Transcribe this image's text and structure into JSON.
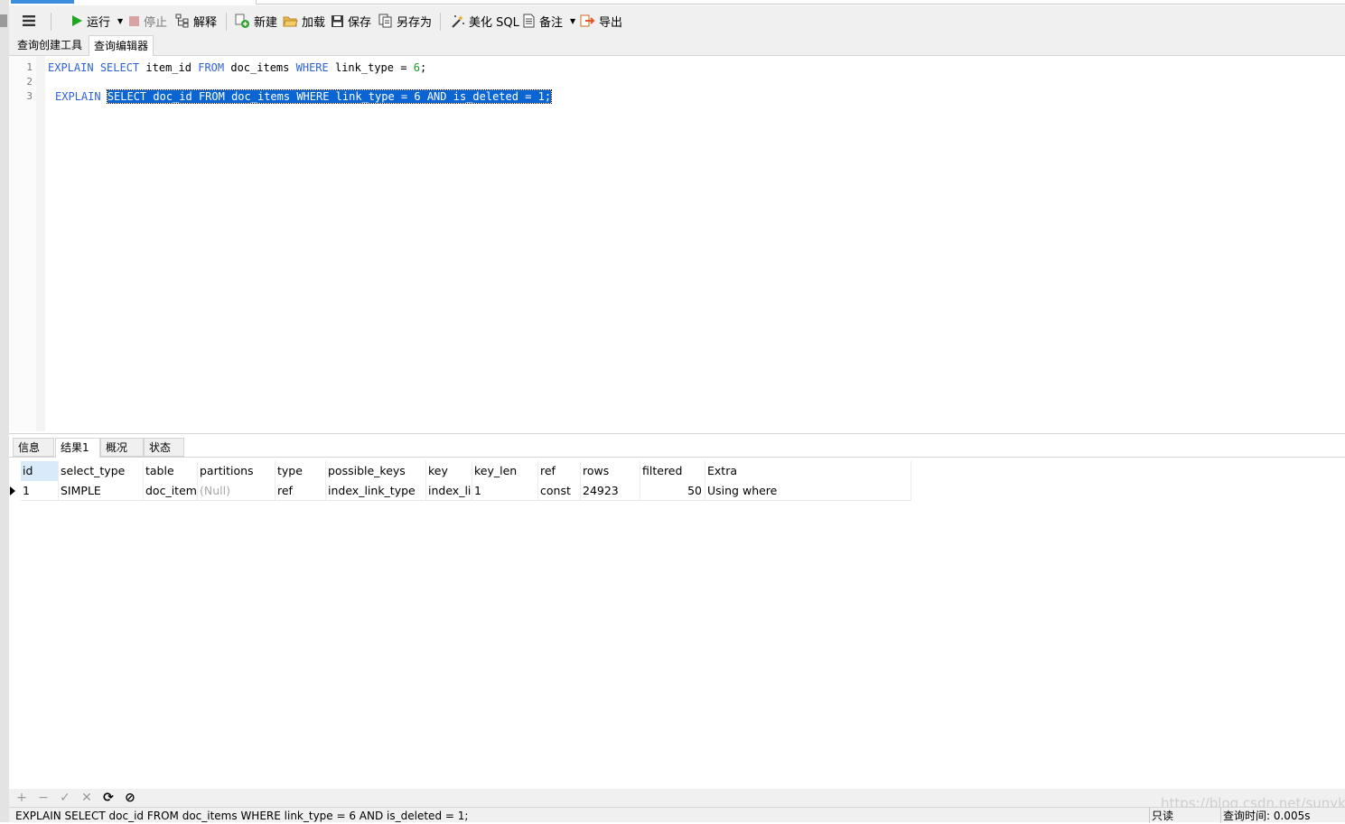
{
  "toolbar": {
    "run_label": "运行",
    "stop_label": "停止",
    "explain_label": "解释",
    "new_label": "新建",
    "load_label": "加载",
    "save_label": "保存",
    "save_as_label": "另存为",
    "beautify_label": "美化 SQL",
    "comment_label": "备注",
    "export_label": "导出"
  },
  "tabs": [
    {
      "label": "查询创建工具"
    },
    {
      "label": "查询编辑器"
    }
  ],
  "editor": {
    "line_numbers": [
      "1",
      "2",
      "3"
    ],
    "line1": {
      "kw1": "EXPLAIN",
      "kw2": "SELECT",
      "t1": "item_id",
      "kw3": "FROM",
      "t2": "doc_items",
      "kw4": "WHERE",
      "t3": "link_type =",
      "n1": "6",
      "t4": ";"
    },
    "line3": {
      "kw1": "EXPLAIN",
      "selected": "SELECT doc_id FROM doc_items WHERE link_type = 6 AND is_deleted = 1;"
    }
  },
  "result_tabs": [
    {
      "label": "信息"
    },
    {
      "label": "结果1"
    },
    {
      "label": "概况"
    },
    {
      "label": "状态"
    }
  ],
  "grid": {
    "columns": [
      "id",
      "select_type",
      "table",
      "partitions",
      "type",
      "possible_keys",
      "key",
      "key_len",
      "ref",
      "rows",
      "filtered",
      "Extra"
    ],
    "row": {
      "id": "1",
      "select_type": "SIMPLE",
      "table": "doc_items",
      "partitions": "(Null)",
      "type": "ref",
      "possible_keys": "index_link_type",
      "key": "index_link_type",
      "key_len": "1",
      "ref": "const",
      "rows": "24923",
      "filtered": "50",
      "extra": "Using where"
    }
  },
  "grid_toolbar": {
    "add": "+",
    "remove": "−",
    "apply": "✓",
    "discard": "✕",
    "refresh": "⟳",
    "stop": "⊘"
  },
  "statusbar": {
    "sql": "EXPLAIN SELECT doc_id FROM doc_items WHERE link_type = 6 AND is_deleted = 1;",
    "mode": "只读",
    "query_time": "查询时间: 0.005s"
  },
  "watermark": "https://blog.csdn.net/sunykk",
  "colors": {
    "keyword": "#2f62d6",
    "number": "#19a02a",
    "selection": "#0a64d2",
    "header_id_bg": "#d9ebfa",
    "null_text": "#a8a8a8"
  }
}
